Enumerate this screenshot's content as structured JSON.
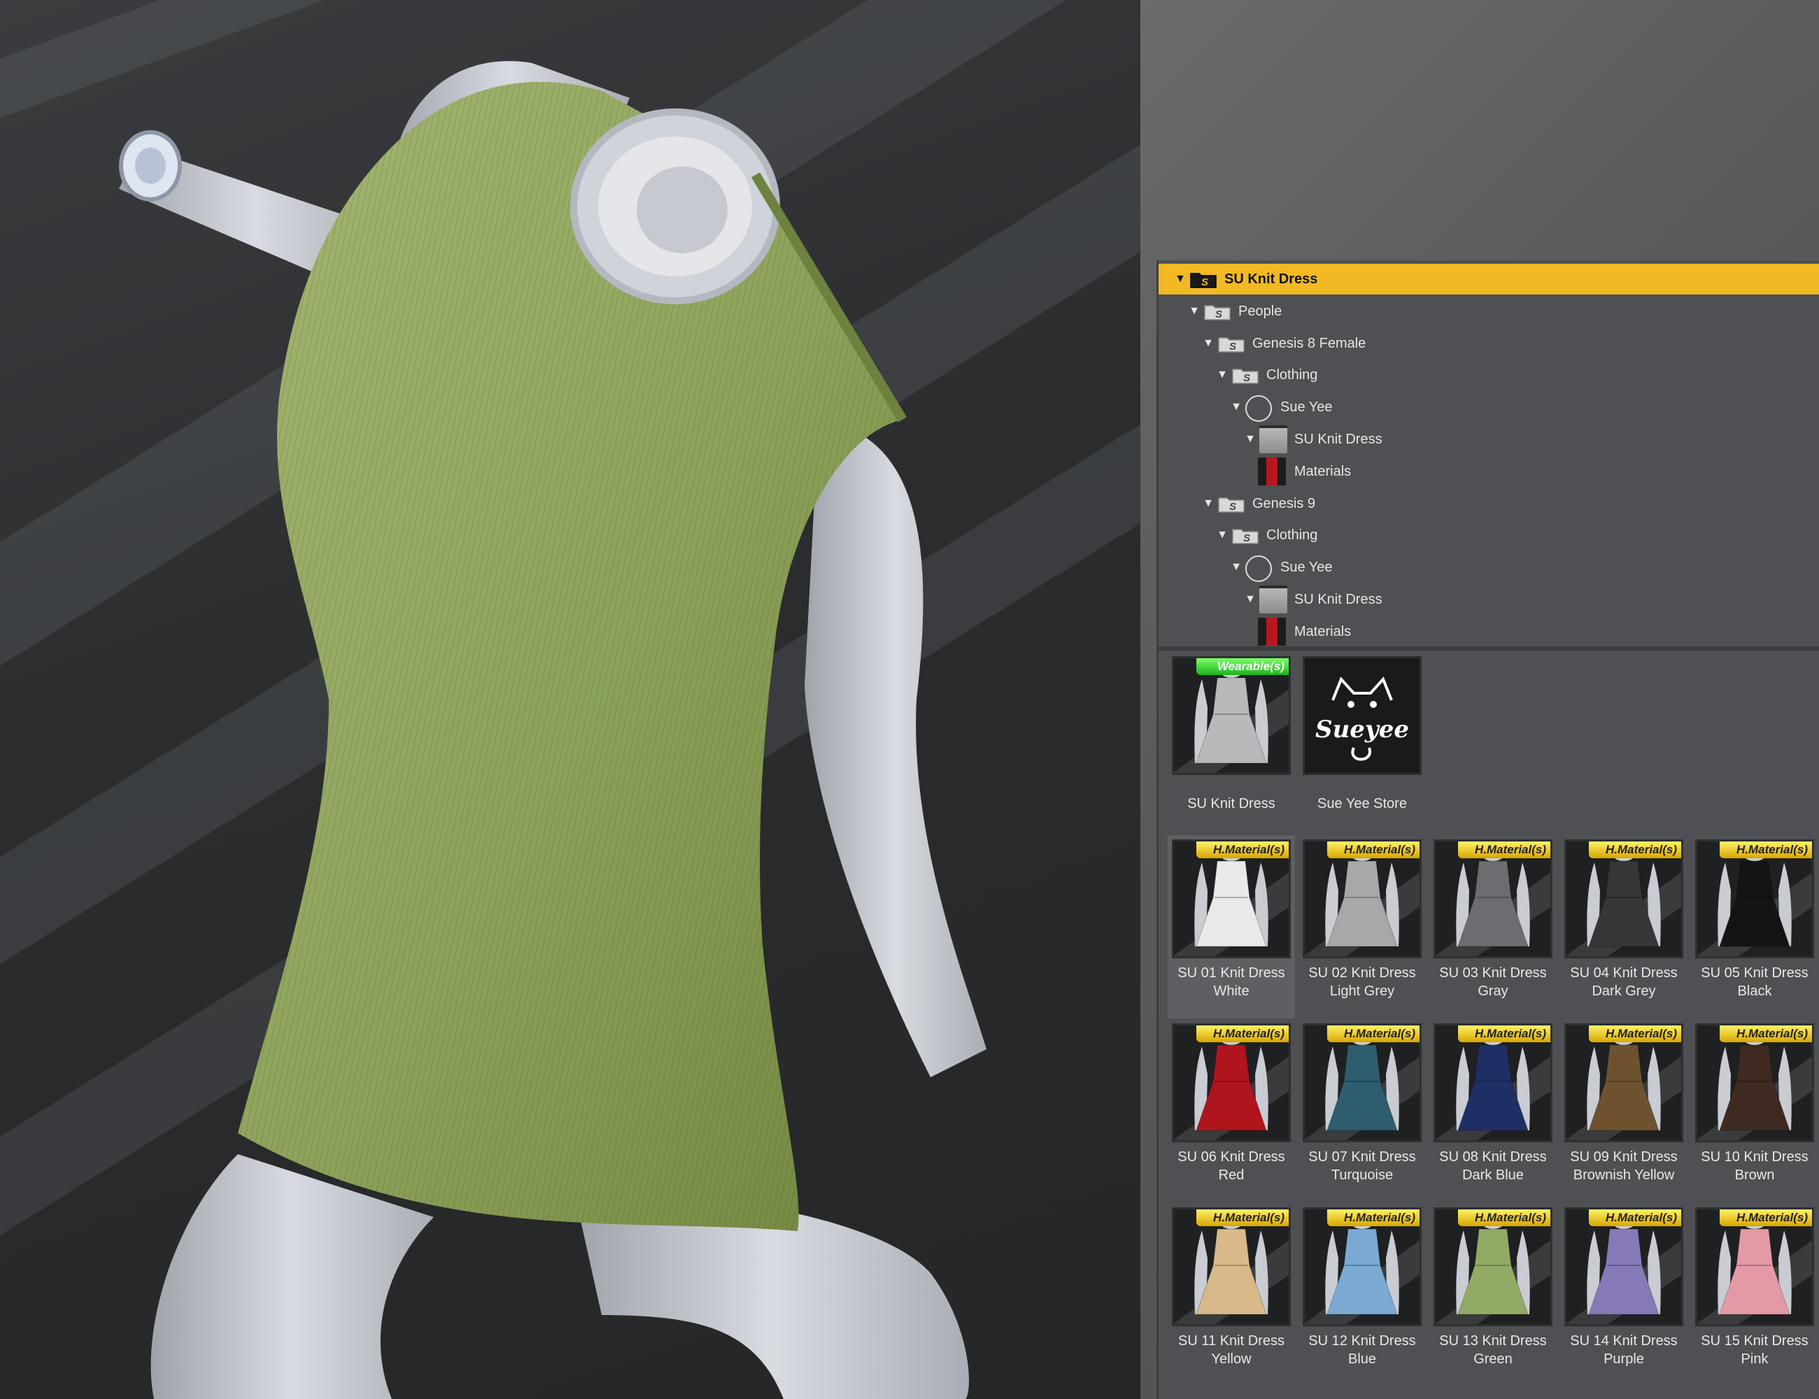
{
  "tree": [
    {
      "label": "SU Knit Dress",
      "icon": "content-folder-icon",
      "selected": true
    },
    {
      "label": "People",
      "icon": "content-folder-icon"
    },
    {
      "label": "Genesis 8 Female",
      "icon": "content-folder-icon"
    },
    {
      "label": "Clothing",
      "icon": "content-folder-icon"
    },
    {
      "label": "Sue Yee",
      "icon": "vendor-logo-icon"
    },
    {
      "label": "SU Knit Dress",
      "icon": "dress-thumbnail-icon"
    },
    {
      "label": "Materials",
      "icon": "materials-thumbnail-icon"
    },
    {
      "label": "Genesis 9",
      "icon": "content-folder-icon"
    },
    {
      "label": "Clothing",
      "icon": "content-folder-icon"
    },
    {
      "label": "Sue Yee",
      "icon": "vendor-logo-icon"
    },
    {
      "label": "SU Knit Dress",
      "icon": "dress-thumbnail-icon"
    },
    {
      "label": "Materials",
      "icon": "materials-thumbnail-icon"
    }
  ],
  "top_items": [
    {
      "label": "SU Knit Dress",
      "badge": "Wearable(s)",
      "dress_color": "#b9b9bb"
    },
    {
      "label": "Sue Yee Store",
      "logo_text": "Sueyee"
    }
  ],
  "materials": [
    {
      "line1": "SU 01 Knit Dress",
      "line2": "White",
      "badge": "H.Material(s)",
      "color": "#e9e9ea"
    },
    {
      "line1": "SU 02 Knit Dress",
      "line2": "Light Grey",
      "badge": "H.Material(s)",
      "color": "#a7a8aa"
    },
    {
      "line1": "SU 03 Knit Dress",
      "line2": "Gray",
      "badge": "H.Material(s)",
      "color": "#6c6d70"
    },
    {
      "line1": "SU 04 Knit Dress",
      "line2": "Dark Grey",
      "badge": "H.Material(s)",
      "color": "#353638"
    },
    {
      "line1": "SU 05 Knit Dress",
      "line2": "Black",
      "badge": "H.Material(s)",
      "color": "#141414"
    },
    {
      "line1": "SU 06 Knit Dress",
      "line2": "Red",
      "badge": "H.Material(s)",
      "color": "#b0141c"
    },
    {
      "line1": "SU 07 Knit Dress",
      "line2": "Turquoise",
      "badge": "H.Material(s)",
      "color": "#2e5d6e"
    },
    {
      "line1": "SU 08 Knit Dress",
      "line2": "Dark Blue",
      "badge": "H.Material(s)",
      "color": "#1f2f66"
    },
    {
      "line1": "SU 09 Knit Dress",
      "line2": "Brownish Yellow",
      "badge": "H.Material(s)",
      "color": "#6e5230"
    },
    {
      "line1": "SU 10 Knit Dress",
      "line2": "Brown",
      "badge": "H.Material(s)",
      "color": "#3e2a20"
    },
    {
      "line1": "SU 11 Knit Dress",
      "line2": "Yellow",
      "badge": "H.Material(s)",
      "color": "#d9b98a"
    },
    {
      "line1": "SU 12 Knit Dress",
      "line2": "Blue",
      "badge": "H.Material(s)",
      "color": "#7aaad4"
    },
    {
      "line1": "SU 13 Knit Dress",
      "line2": "Green",
      "badge": "H.Material(s)",
      "color": "#93aa64"
    },
    {
      "line1": "SU 14 Knit Dress",
      "line2": "Purple",
      "badge": "H.Material(s)",
      "color": "#8779b8"
    },
    {
      "line1": "SU 15 Knit Dress",
      "line2": "Pink",
      "badge": "H.Material(s)",
      "color": "#e49aa6"
    }
  ],
  "colors": {
    "selection": "#f2b924",
    "dress_render": "#93a862",
    "mannequin": "#c9ccd3"
  }
}
